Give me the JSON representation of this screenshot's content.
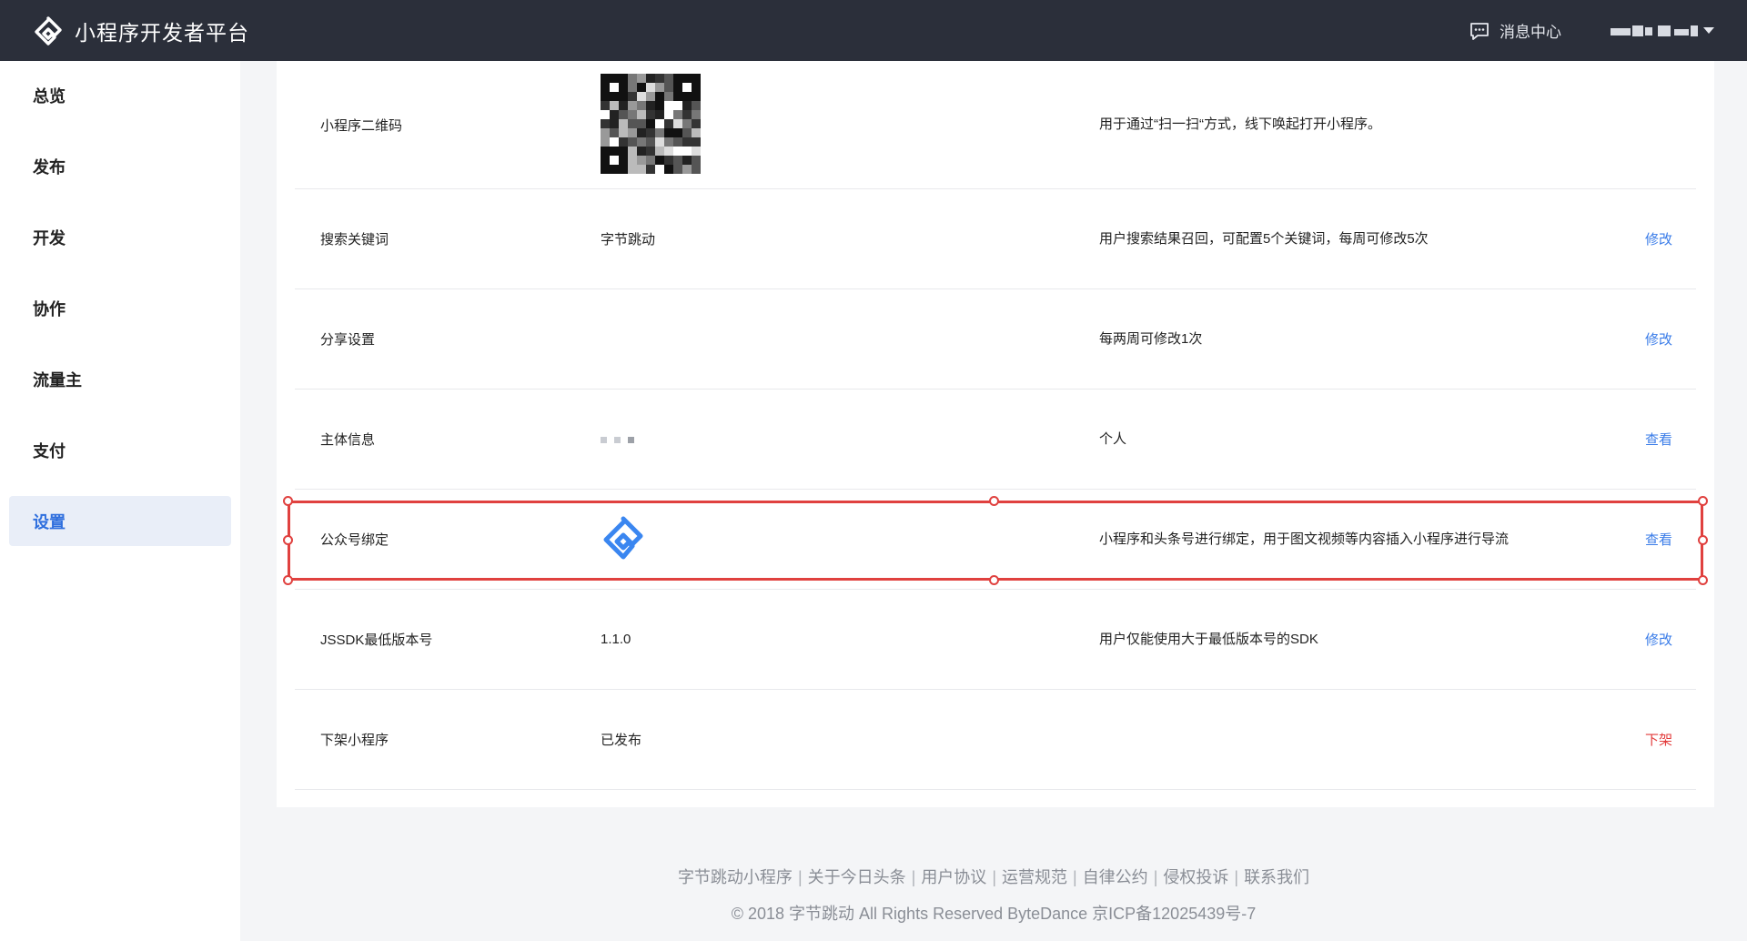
{
  "header": {
    "title": "小程序开发者平台",
    "logo_icon": "bytedance-miniapp-logo-icon",
    "message_center": "消息中心",
    "message_icon": "message-icon"
  },
  "sidebar": {
    "items": [
      {
        "label": "总览",
        "active": false
      },
      {
        "label": "发布",
        "active": false
      },
      {
        "label": "开发",
        "active": false
      },
      {
        "label": "协作",
        "active": false
      },
      {
        "label": "流量主",
        "active": false
      },
      {
        "label": "支付",
        "active": false
      },
      {
        "label": "设置",
        "active": true
      }
    ]
  },
  "settings": {
    "rows": [
      {
        "label": "小程序二维码",
        "value": "",
        "desc": "用于通过“扫一扫“方式，线下唤起打开小程序。",
        "action": ""
      },
      {
        "label": "搜索关键词",
        "value": "字节跳动",
        "desc": "用户搜索结果召回，可配置5个关键词，每周可修改5次",
        "action": "修改"
      },
      {
        "label": "分享设置",
        "value": "",
        "desc": "每两周可修改1次",
        "action": "修改"
      },
      {
        "label": "主体信息",
        "value": "",
        "desc": "个人",
        "action": "查看"
      },
      {
        "label": "公众号绑定",
        "value": "",
        "desc": "小程序和头条号进行绑定，用于图文视频等内容插入小程序进行导流",
        "action": "查看"
      },
      {
        "label": "JSSDK最低版本号",
        "value": "1.1.0",
        "desc": "用户仅能使用大于最低版本号的SDK",
        "action": "修改"
      },
      {
        "label": "下架小程序",
        "value": "已发布",
        "desc": "",
        "action": "下架"
      }
    ]
  },
  "footer": {
    "links": [
      "字节跳动小程序",
      "关于今日头条",
      "用户协议",
      "运营规范",
      "自律公约",
      "侵权投诉",
      "联系我们"
    ],
    "separator": "|",
    "copyright": "© 2018 字节跳动 All Rights Reserved ByteDance 京ICP备12025439号-7"
  },
  "colors": {
    "topbar": "#2b2f3a",
    "accent": "#3a7ce8",
    "danger": "#e23b3b",
    "selection": "#e0413f"
  }
}
